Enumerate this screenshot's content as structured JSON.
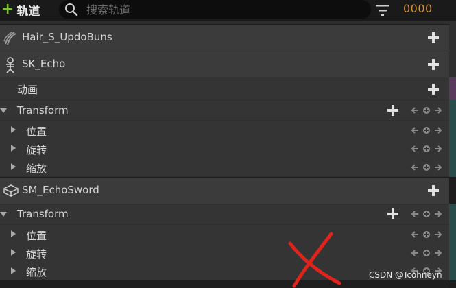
{
  "toolbar": {
    "add_track_plus": "+",
    "add_track_label": "轨道",
    "search_placeholder": "搜索轨道",
    "frame_value": "0000",
    "filter_icon": "filter-icon"
  },
  "tracks": [
    {
      "name": "Hair_S_UpdoBuns",
      "icon": "hair-groom-icon"
    },
    {
      "name": "SK_Echo",
      "icon": "skeleton-icon"
    },
    {
      "name": "动画"
    },
    {
      "name": "Transform"
    },
    {
      "name": "位置"
    },
    {
      "name": "旋转"
    },
    {
      "name": "缩放"
    },
    {
      "name": "SM_EchoSword",
      "icon": "static-mesh-icon"
    },
    {
      "name": "Transform"
    },
    {
      "name": "位置"
    },
    {
      "name": "旋转"
    },
    {
      "name": "缩放"
    }
  ],
  "colors": {
    "accent_add": "#7cc42a",
    "frame_counter": "#d7952a",
    "annotation_x": "#e0241b"
  },
  "watermark": "CSDN @Tcohneyn"
}
